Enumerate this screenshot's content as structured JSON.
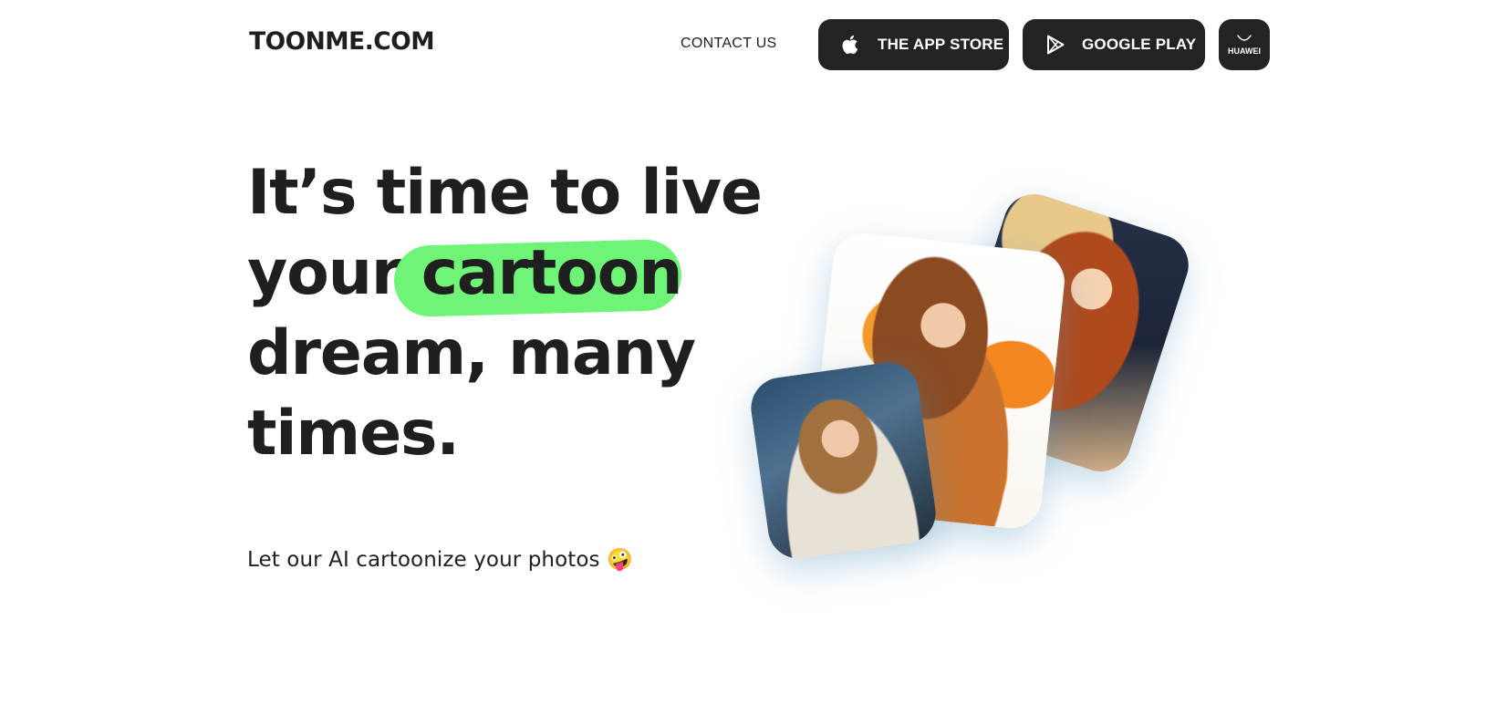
{
  "header": {
    "logo": "TOONME.COM",
    "contact": "CONTACT US",
    "stores": {
      "appstore": {
        "label": "THE APP STORE",
        "icon": "apple-icon"
      },
      "google": {
        "label": "GOOGLE PLAY",
        "icon": "google-play-icon"
      },
      "huawei": {
        "label": "HUAWEI",
        "icon": "huawei-bag-icon"
      }
    }
  },
  "hero": {
    "headline_line1": "It’s time to live",
    "headline_line2_pre": "your",
    "headline_highlight": "cartoon",
    "headline_line3": "dream, many",
    "headline_line4": "times.",
    "subtitle": "Let our AI cartoonize your photos",
    "subtitle_emoji": "🤪"
  },
  "colors": {
    "highlight": "#6ef577",
    "button_bg": "#232323",
    "text": "#1f1f1f"
  }
}
